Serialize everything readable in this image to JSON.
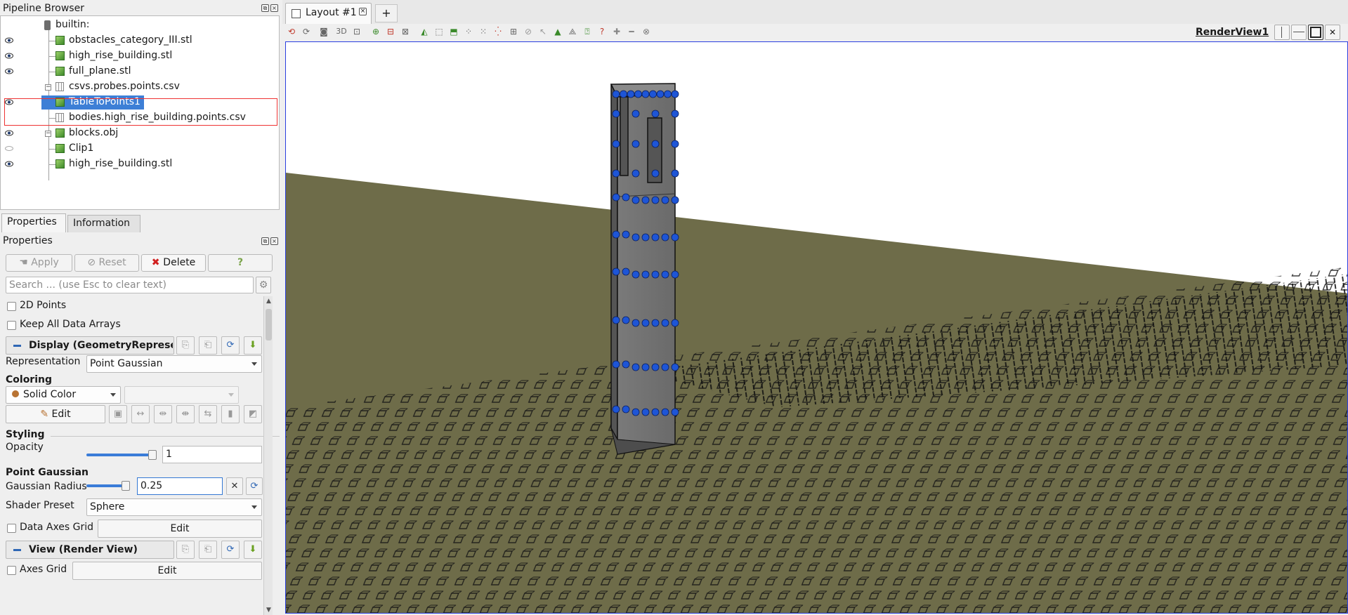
{
  "pipeline_browser": {
    "title": "Pipeline Browser",
    "items": [
      {
        "label": "builtin:"
      },
      {
        "label": "obstacles_category_III.stl"
      },
      {
        "label": "high_rise_building.stl"
      },
      {
        "label": "full_plane.stl"
      },
      {
        "label": "csvs.probes.points.csv"
      },
      {
        "label": "TableToPoints1"
      },
      {
        "label": "bodies.high_rise_building.points.csv"
      },
      {
        "label": "blocks.obj"
      },
      {
        "label": "Clip1"
      },
      {
        "label": "high_rise_building.stl"
      }
    ]
  },
  "tabs": {
    "properties": "Properties",
    "information": "Information"
  },
  "properties": {
    "title": "Properties",
    "apply": "Apply",
    "reset": "Reset",
    "delete": "Delete",
    "help": "?",
    "search_placeholder": "Search ... (use Esc to clear text)",
    "points_2d": "2D Points",
    "keep_all": "Keep All Data Arrays",
    "display_section": "Display (GeometryRepresentation)",
    "representation_label": "Representation",
    "representation_value": "Point Gaussian",
    "coloring_header": "Coloring",
    "coloring_value": "Solid Color",
    "edit": "Edit",
    "styling_header": "Styling",
    "opacity_label": "Opacity",
    "opacity_value": "1",
    "opacity_fraction": 1.0,
    "point_gaussian_header": "Point Gaussian",
    "gaussian_radius_label": "Gaussian Radius",
    "gaussian_radius_value": "0.25",
    "shader_preset_label": "Shader Preset",
    "shader_preset_value": "Sphere",
    "data_axes_grid": "Data Axes Grid",
    "view_section": "View (Render View)",
    "axes_grid": "Axes Grid"
  },
  "layout": {
    "tab_label": "Layout #1",
    "add_tab": "+",
    "toolbar_3d": "3D",
    "render_view_label": "RenderView1"
  },
  "colors": {
    "selection": "#3d7fd6",
    "ground": "#6e6c49",
    "building": "#6b6b6b",
    "probe": "#1e55d6",
    "view_border": "#2b3fe0"
  }
}
